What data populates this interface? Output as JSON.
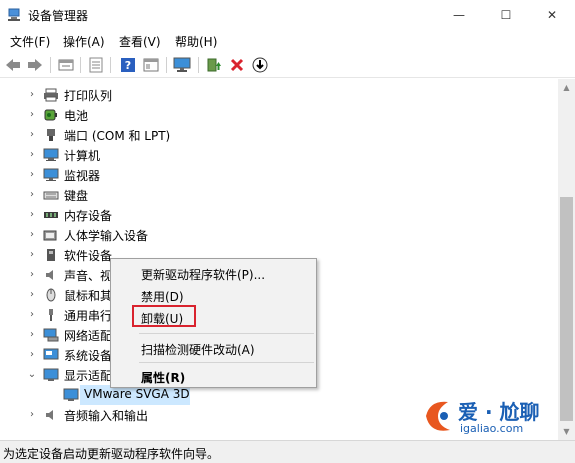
{
  "window": {
    "title": "设备管理器",
    "minimize": "—",
    "maximize": "☐",
    "close": "✕"
  },
  "menu": {
    "file": "文件(F)",
    "action": "操作(A)",
    "view": "查看(V)",
    "help": "帮助(H)"
  },
  "toolbar": {
    "icons": [
      "back-icon",
      "forward-icon",
      "properties-icon",
      "list-icon",
      "help-icon",
      "view-icon",
      "monitor-icon",
      "update-driver-icon",
      "uninstall-icon",
      "download-icon"
    ]
  },
  "tree": {
    "items": [
      {
        "label": "打印队列",
        "expanded": false,
        "icon": "printer-icon"
      },
      {
        "label": "电池",
        "expanded": false,
        "icon": "battery-icon"
      },
      {
        "label": "端口 (COM 和 LPT)",
        "expanded": false,
        "icon": "port-icon"
      },
      {
        "label": "计算机",
        "expanded": false,
        "icon": "computer-icon"
      },
      {
        "label": "监视器",
        "expanded": false,
        "icon": "monitor-icon"
      },
      {
        "label": "键盘",
        "expanded": false,
        "icon": "keyboard-icon"
      },
      {
        "label": "内存设备",
        "expanded": false,
        "icon": "memory-icon"
      },
      {
        "label": "人体学输入设备",
        "expanded": false,
        "icon": "hid-icon"
      },
      {
        "label": "软件设备",
        "expanded": false,
        "icon": "software-icon"
      },
      {
        "label": "声音、视",
        "expanded": false,
        "icon": "sound-icon"
      },
      {
        "label": "鼠标和其",
        "expanded": false,
        "icon": "mouse-icon"
      },
      {
        "label": "通用串行",
        "expanded": false,
        "icon": "usb-icon"
      },
      {
        "label": "网络适配",
        "expanded": false,
        "icon": "network-icon"
      },
      {
        "label": "系统设备",
        "expanded": false,
        "icon": "system-icon"
      },
      {
        "label": "显示适配",
        "expanded": true,
        "icon": "display-icon"
      },
      {
        "label": "VMware SVGA 3D",
        "child": true,
        "selected": true,
        "icon": "display-adapter-icon"
      },
      {
        "label": "音频输入和输出",
        "expanded": false,
        "icon": "audio-icon"
      }
    ]
  },
  "context_menu": {
    "update": "更新驱动程序软件(P)...",
    "disable": "禁用(D)",
    "uninstall": "卸载(U)",
    "scan": "扫描检测硬件改动(A)",
    "properties": "属性(R)"
  },
  "status": {
    "text": "为选定设备启动更新驱动程序软件向导。"
  },
  "watermark": {
    "line1": "爱 · 尬聊",
    "line2": "igaliao.com"
  },
  "colors": {
    "selection": "#cce8ff",
    "highlight_box": "#d9232e",
    "uninstall_x": "#d9232e"
  }
}
